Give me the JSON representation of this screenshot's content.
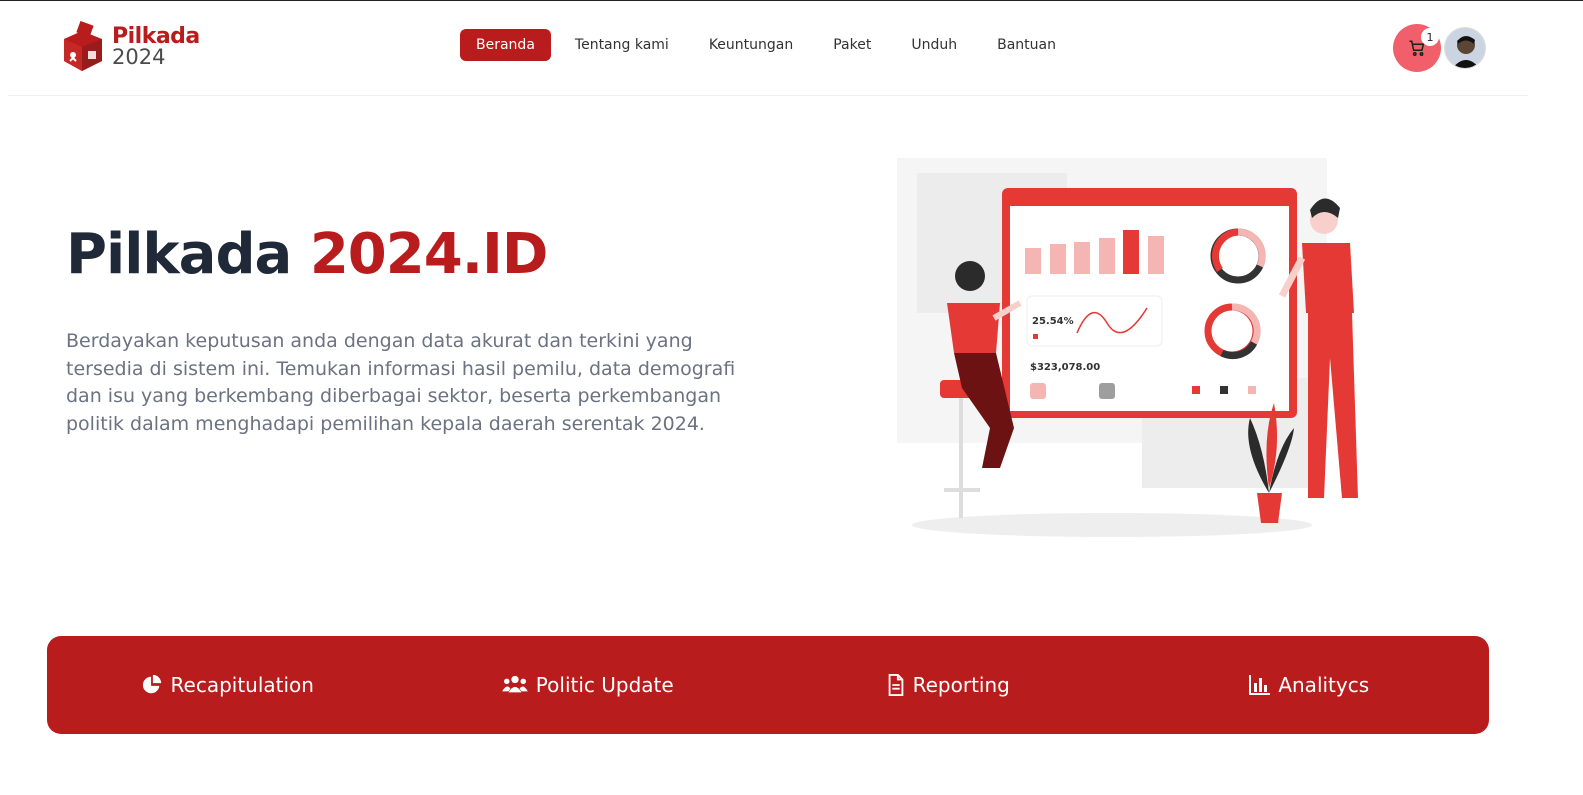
{
  "logo": {
    "top": "Pilkada",
    "bottom": "2024"
  },
  "nav": {
    "items": [
      {
        "label": "Beranda",
        "active": true
      },
      {
        "label": "Tentang kami"
      },
      {
        "label": "Keuntungan"
      },
      {
        "label": "Paket"
      },
      {
        "label": "Unduh"
      },
      {
        "label": "Bantuan"
      }
    ]
  },
  "cart": {
    "count": "1",
    "icon": "cart-icon"
  },
  "hero": {
    "title_part1": "Pilkada ",
    "title_part2": "2024.ID",
    "description": "Berdayakan keputusan anda dengan data akurat dan terkini yang tersedia di sistem ini. Temukan informasi hasil pemilu, data demografi dan isu yang berkembang diberbagai sektor, beserta perkembangan politik dalam menghadapi pemilihan kepala daerah serentak 2024."
  },
  "illustration": {
    "percent": "25.54%",
    "amount": "$323,078.00"
  },
  "features": [
    {
      "label": "Recapitulation",
      "icon": "pie-chart-icon"
    },
    {
      "label": "Politic Update",
      "icon": "users-icon"
    },
    {
      "label": "Reporting",
      "icon": "document-icon"
    },
    {
      "label": "Analitycs",
      "icon": "bar-chart-icon"
    }
  ],
  "colors": {
    "brand": "#b91c1c",
    "cart_bg": "#f05f6a",
    "title_dark": "#1f2937",
    "body_text": "#6b7280"
  }
}
